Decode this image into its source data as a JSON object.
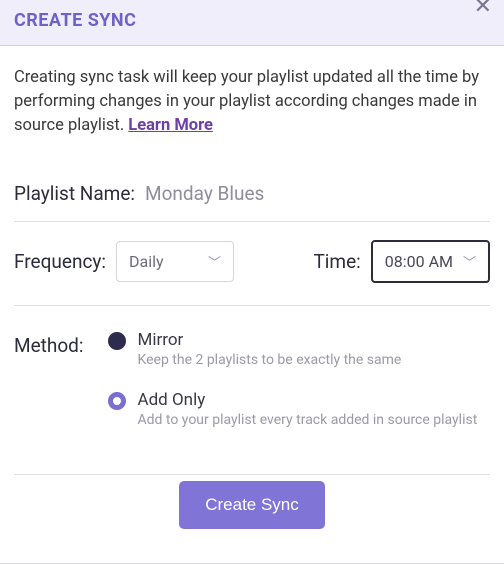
{
  "header": {
    "title": "CREATE SYNC"
  },
  "intro": {
    "text": "Creating sync task will keep your playlist updated all the time by performing changes in your playlist according changes made in source playlist. ",
    "learn_more": "Learn More"
  },
  "playlist": {
    "label": "Playlist Name:",
    "value": "Monday Blues"
  },
  "frequency": {
    "label": "Frequency:",
    "value": "Daily"
  },
  "time": {
    "label": "Time:",
    "value": "08:00 AM"
  },
  "method": {
    "label": "Method:",
    "options": [
      {
        "title": "Mirror",
        "desc": "Keep the 2 playlists to be exactly the same",
        "selected": false
      },
      {
        "title": "Add Only",
        "desc": "Add to your playlist every track added in source playlist",
        "selected": true
      }
    ]
  },
  "actions": {
    "create": "Create Sync"
  }
}
